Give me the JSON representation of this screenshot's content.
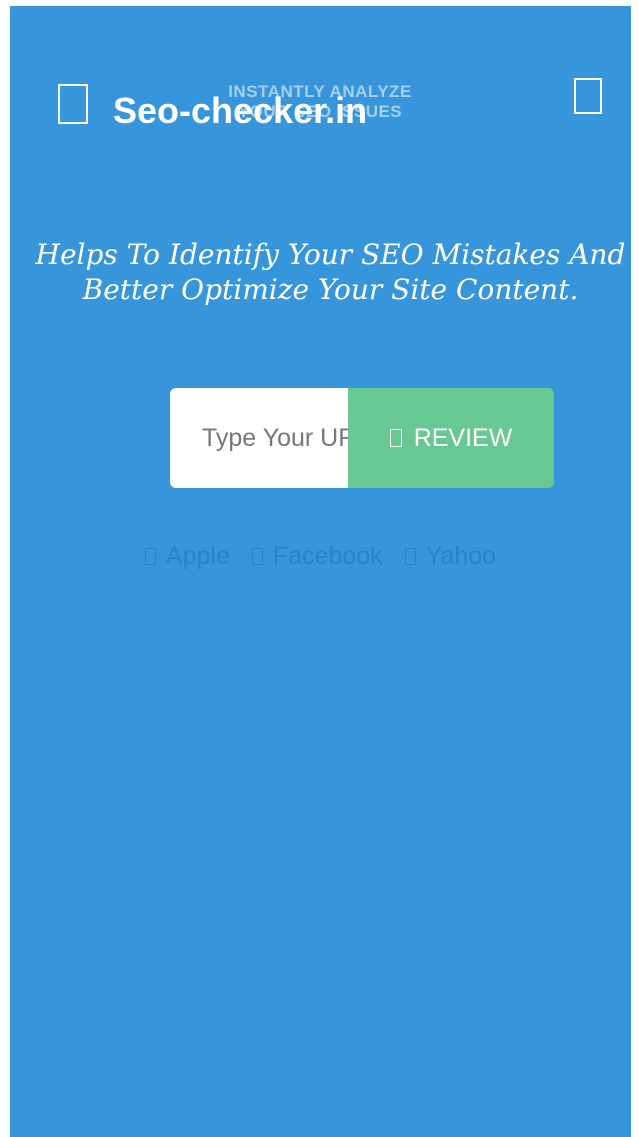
{
  "header": {
    "brand": "Seo-checker.in",
    "tagline_line1": "INSTANTLY ANALYZE",
    "tagline_line2": "YOUR SEO ISSUES",
    "menu_icon": "menu-icon",
    "right_icon": "square-icon"
  },
  "hero": {
    "headline": "Helps To Identify Your SEO Mistakes And Better Optimize Your Site Content."
  },
  "search": {
    "placeholder": "Type Your URL",
    "review_label": "REVIEW",
    "review_icon": "search-icon"
  },
  "examples": [
    {
      "label": "Apple",
      "icon": "apple-icon"
    },
    {
      "label": "Facebook",
      "icon": "facebook-icon"
    },
    {
      "label": "Yahoo",
      "icon": "yahoo-icon"
    }
  ],
  "colors": {
    "background": "#3796db",
    "review_button": "#68c891",
    "example_text": "#2c80c4"
  }
}
